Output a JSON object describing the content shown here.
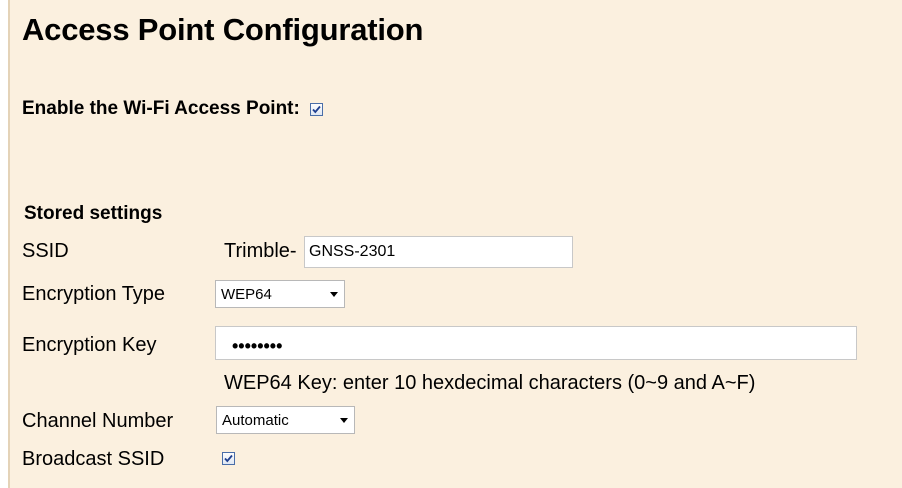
{
  "page": {
    "title": "Access Point Configuration",
    "enable_label": "Enable the Wi-Fi Access Point:",
    "enable_checked": true
  },
  "stored_settings": {
    "heading": "Stored settings",
    "ssid": {
      "label": "SSID",
      "prefix": "Trimble-",
      "value": "GNSS-2301"
    },
    "encryption_type": {
      "label": "Encryption Type",
      "selected": "WEP64"
    },
    "encryption_key": {
      "label": "Encryption Key",
      "masked_value": "••••••••",
      "hint": "WEP64 Key: enter 10 hexdecimal characters (0~9 and A~F)"
    },
    "channel_number": {
      "label": "Channel Number",
      "selected": "Automatic"
    },
    "broadcast_ssid": {
      "label": "Broadcast SSID",
      "checked": true
    }
  },
  "colors": {
    "background": "#fbf0df",
    "checkbox_border": "#4a6ea8",
    "checkmark": "#1f3f8f"
  }
}
